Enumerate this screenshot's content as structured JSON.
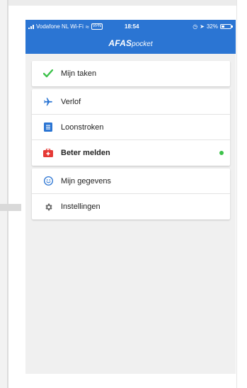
{
  "status_bar": {
    "carrier": "Vodafone NL Wi-Fi",
    "vpn": "VPN",
    "time": "18:54",
    "battery": "32%",
    "battery_level": 0.32
  },
  "app": {
    "brand": "AFAS",
    "brand_suffix": "pocket"
  },
  "menu": {
    "tasks": {
      "label": "Mijn taken",
      "icon": "checkmark-icon",
      "color": "#3cc24a"
    },
    "leave": {
      "label": "Verlof",
      "icon": "airplane-icon",
      "color": "#2b75d3"
    },
    "payslips": {
      "label": "Loonstroken",
      "icon": "document-icon",
      "color": "#2b75d3"
    },
    "sick": {
      "label": "Beter melden",
      "icon": "first-aid-icon",
      "color": "#e53935",
      "status": "green-dot"
    },
    "my_data": {
      "label": "Mijn gegevens",
      "icon": "smiley-icon",
      "color": "#2b75d3"
    },
    "settings": {
      "label": "Instellingen",
      "icon": "gear-icon",
      "color": "#666666"
    }
  }
}
